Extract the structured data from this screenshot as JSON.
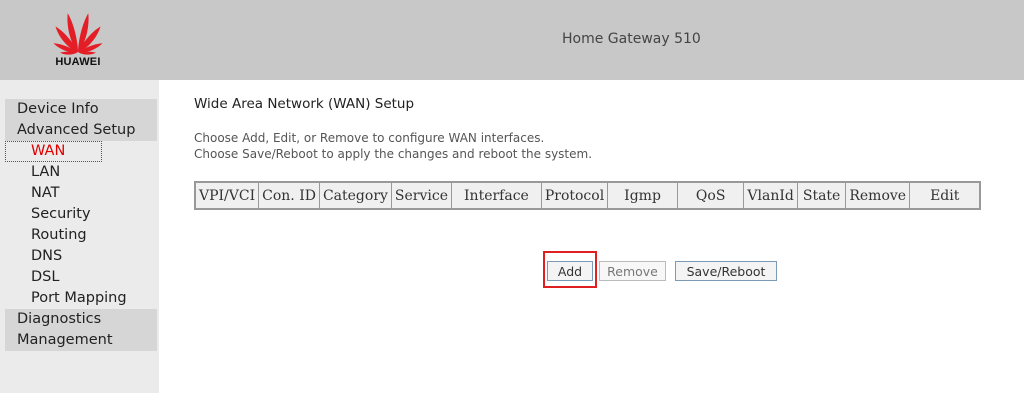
{
  "brand": {
    "logo_text": "HUAWEI",
    "title": "Home Gateway 510",
    "accent_color": "#e00000"
  },
  "sidebar": {
    "items": [
      {
        "label": "Device Info",
        "level": "top"
      },
      {
        "label": "Advanced Setup",
        "level": "top"
      },
      {
        "label": "WAN",
        "level": "sub",
        "active": true
      },
      {
        "label": "LAN",
        "level": "sub"
      },
      {
        "label": "NAT",
        "level": "sub"
      },
      {
        "label": "Security",
        "level": "sub"
      },
      {
        "label": "Routing",
        "level": "sub"
      },
      {
        "label": "DNS",
        "level": "sub"
      },
      {
        "label": "DSL",
        "level": "sub"
      },
      {
        "label": "Port Mapping",
        "level": "sub"
      },
      {
        "label": "Diagnostics",
        "level": "top"
      },
      {
        "label": "Management",
        "level": "top"
      }
    ]
  },
  "main": {
    "heading": "Wide Area Network (WAN) Setup",
    "desc_line1": "Choose Add, Edit, or Remove to configure WAN interfaces.",
    "desc_line2": "Choose Save/Reboot to apply the changes and reboot the system.",
    "table": {
      "columns": [
        "VPI/VCI",
        "Con. ID",
        "Category",
        "Service",
        "Interface",
        "Protocol",
        "Igmp",
        "QoS",
        "VlanId",
        "State",
        "Remove",
        "Edit"
      ]
    },
    "buttons": {
      "add": "Add",
      "remove": "Remove",
      "save_reboot": "Save/Reboot"
    }
  }
}
